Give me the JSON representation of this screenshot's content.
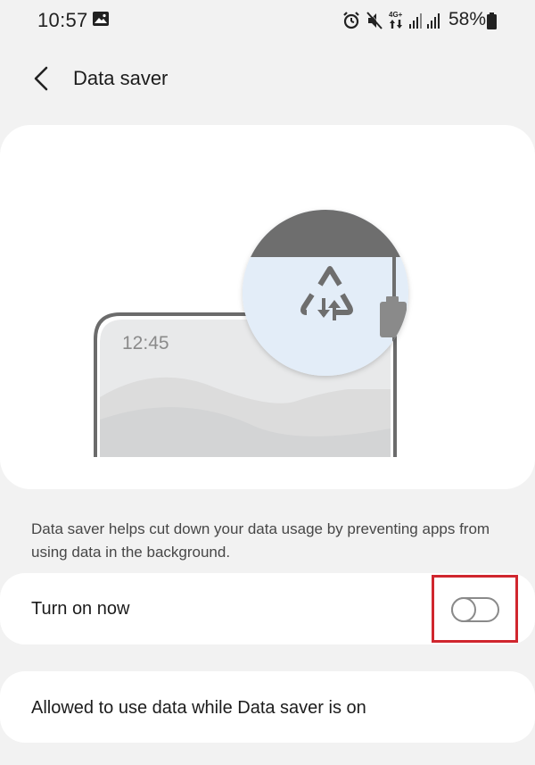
{
  "status_bar": {
    "time": "10:57",
    "battery_percent": "58%",
    "network_label": "4G+",
    "icons": [
      "image-icon",
      "alarm-icon",
      "mute-icon",
      "data-arrows-icon",
      "signal-icon",
      "signal-icon",
      "battery-icon"
    ]
  },
  "header": {
    "title": "Data saver",
    "back_icon": "chevron-left-icon"
  },
  "illustration": {
    "phone_time": "12:45",
    "icon": "data-saver-icon"
  },
  "description": "Data saver helps cut down your data usage by preventing apps from using data in the background.",
  "settings": {
    "turn_on_label": "Turn on now",
    "turn_on_state": "off",
    "allowed_label": "Allowed to use data while Data saver is on"
  },
  "colors": {
    "background": "#f2f2f2",
    "card": "#ffffff",
    "highlight": "#d0262e",
    "magnifier_fill": "#e3edf8",
    "icon_gray": "#757575"
  }
}
